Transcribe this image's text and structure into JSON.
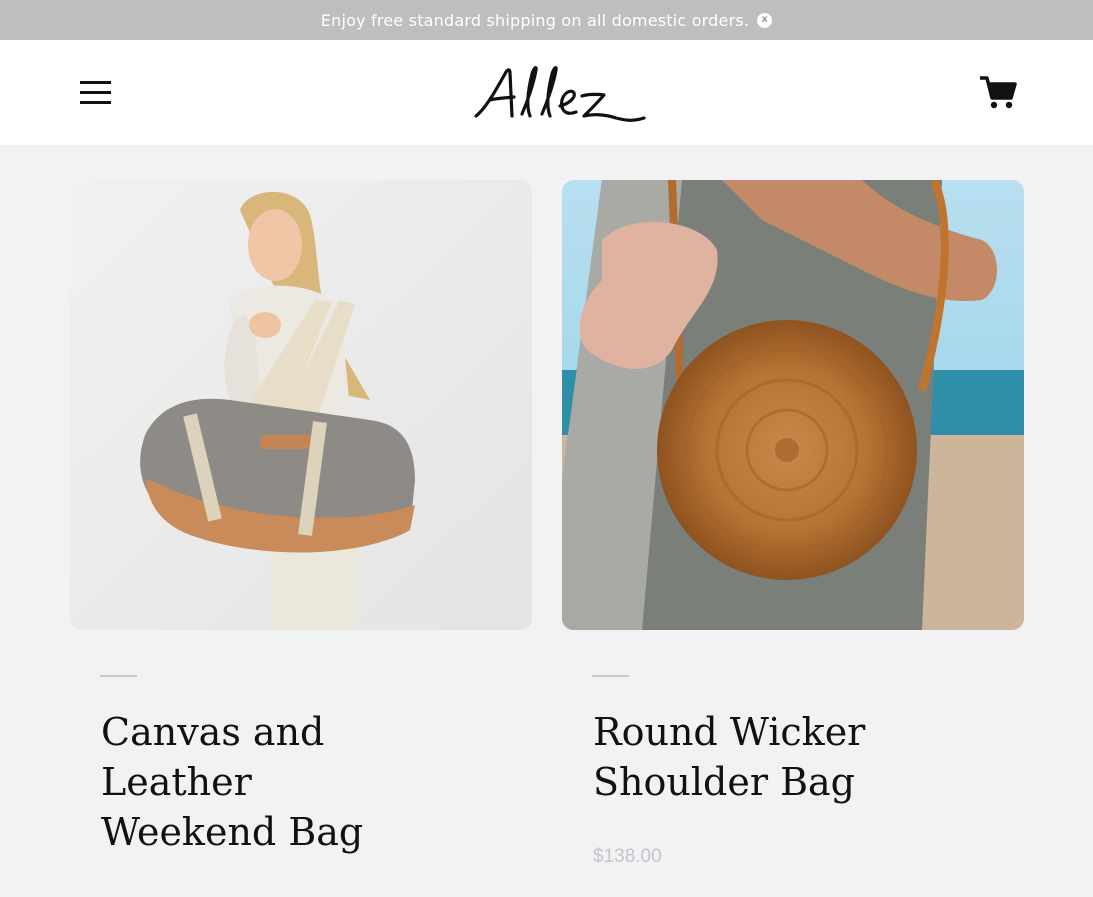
{
  "announcement": {
    "text": "Enjoy free standard shipping on all domestic orders.",
    "close_label": "x"
  },
  "header": {
    "logo_text": "Allez",
    "menu_icon": "hamburger-icon",
    "cart_icon": "cart-icon"
  },
  "products": [
    {
      "title": "Canvas and Leather Weekend Bag",
      "price": "",
      "image": "woman-carrying-canvas-duffel-bag"
    },
    {
      "title": "Round Wicker Shoulder Bag",
      "price": "$138.00",
      "image": "round-wicker-bag-with-silk-scarf"
    }
  ],
  "colors": {
    "announcement_bg": "#bebebe",
    "page_bg": "#f2f2f4",
    "header_bg": "#ffffff",
    "price": "#c4c4c8"
  }
}
